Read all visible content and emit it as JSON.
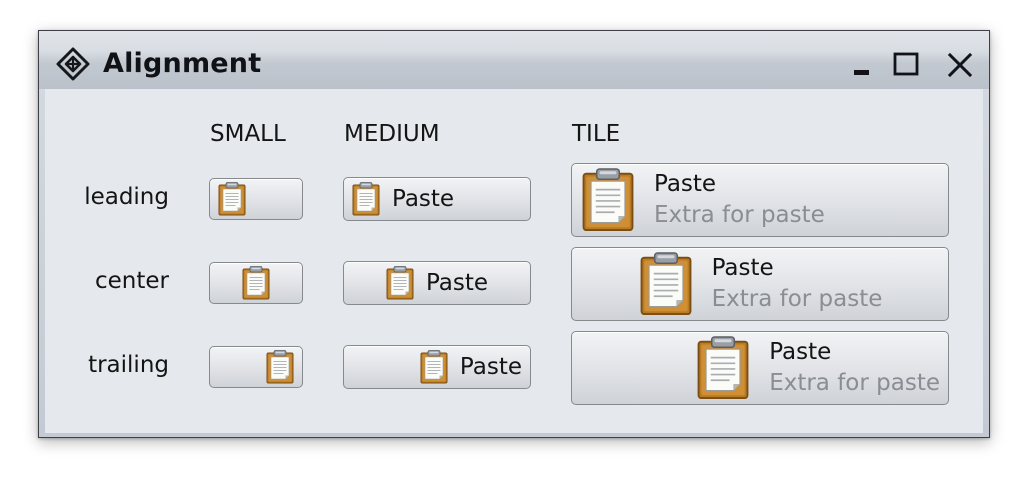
{
  "window": {
    "title": "Alignment",
    "icon": "diamond-grid-icon",
    "controls": {
      "minimize": "minimize-icon",
      "maximize": "maximize-icon",
      "close": "close-icon"
    }
  },
  "columns": {
    "small": "SMALL",
    "medium": "MEDIUM",
    "tile": "TILE"
  },
  "rows": {
    "leading": "leading",
    "center": "center",
    "trailing": "trailing"
  },
  "button": {
    "icon": "clipboard-paste-icon",
    "label": "Paste",
    "extra": "Extra for paste"
  },
  "colors": {
    "content_background": "#e5e8ec",
    "titlebar_background": "#c3c9d1",
    "extra_text": "#8a8d91",
    "clipboard_board": "#b87a25"
  }
}
